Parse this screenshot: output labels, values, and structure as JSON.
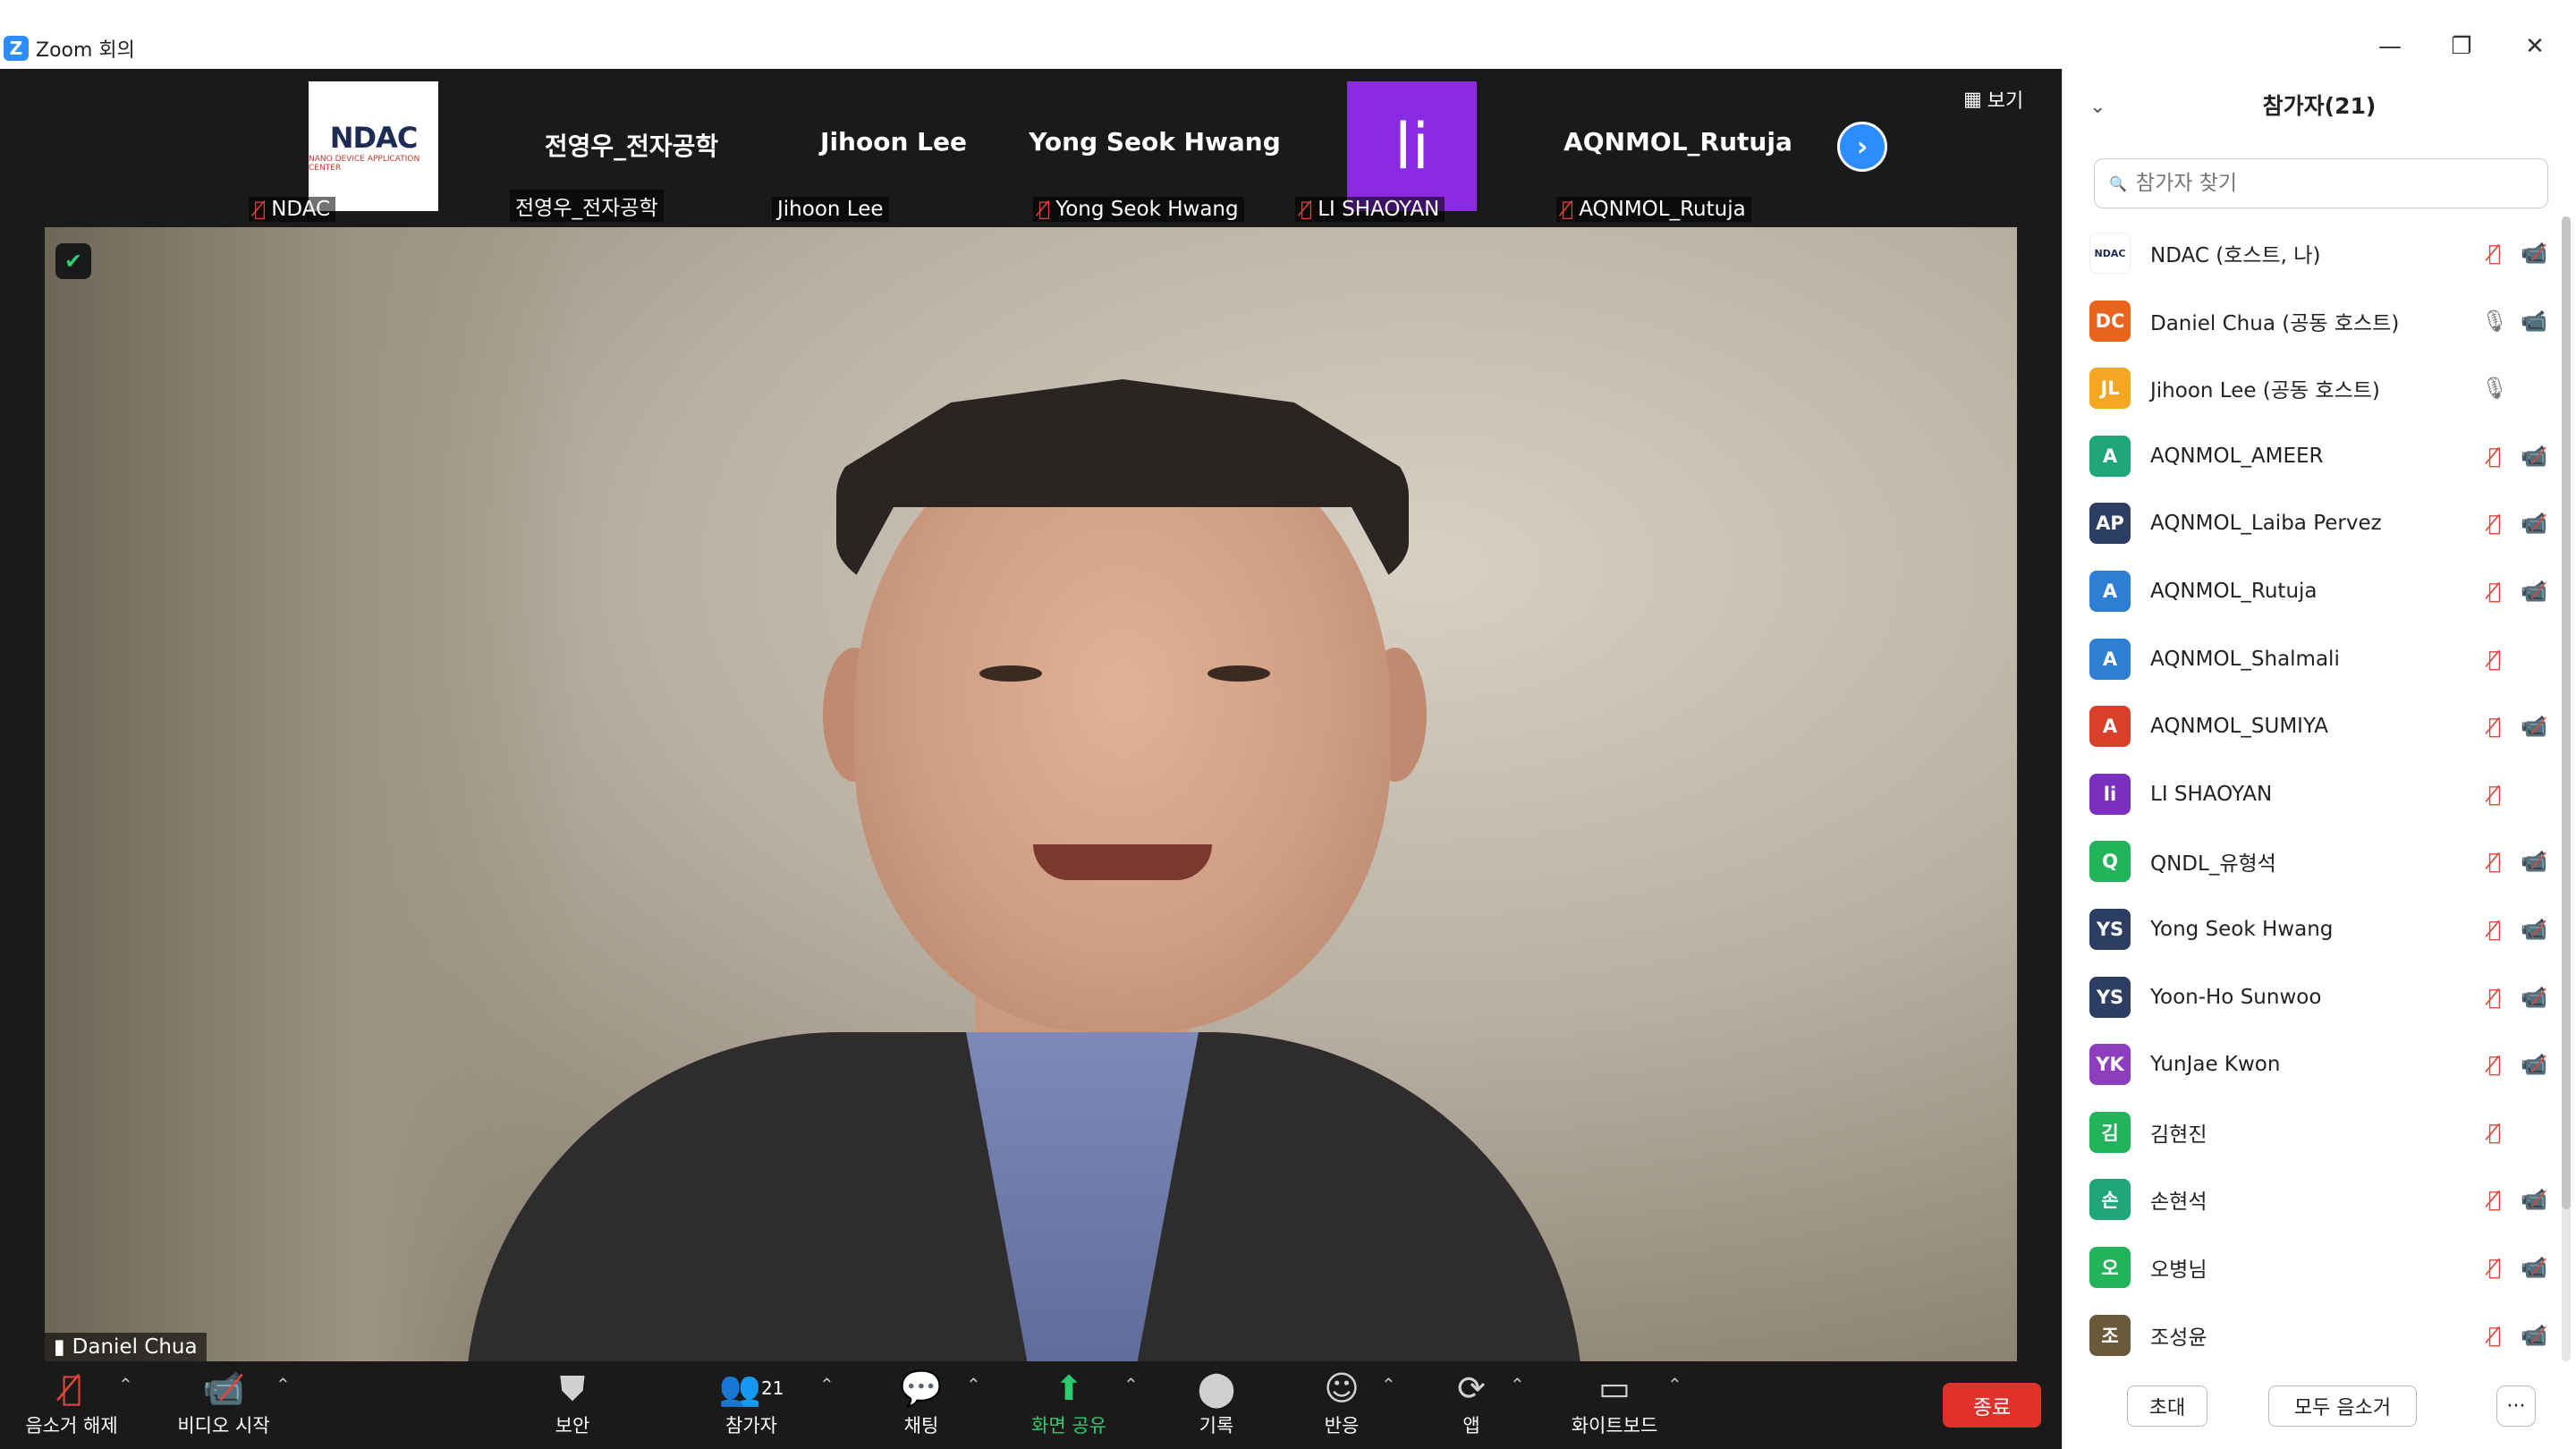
{
  "window": {
    "title": "Zoom 회의",
    "logo_letter": "Z",
    "minimize": "—",
    "restore": "❐",
    "close": "✕"
  },
  "strip": {
    "tiles": [
      {
        "label": "NDAC",
        "logo_text": "NDAC",
        "logo_small": "NANO DEVICE APPLICATION CENTER",
        "muted": true
      },
      {
        "center_name": "전영우_전자공학",
        "label": "전영우_전자공학",
        "muted": false
      },
      {
        "center_name": "Jihoon Lee",
        "label": "Jihoon Lee",
        "muted": false
      },
      {
        "center_name": "Yong Seok Hwang",
        "label": "Yong Seok Hwang",
        "muted": true
      },
      {
        "avatar": "li",
        "label": "LI SHAOYAN",
        "muted": true
      },
      {
        "center_name": "AQNMOL_Rutuja",
        "label": "AQNMOL_Rutuja",
        "muted": true
      }
    ],
    "next_icon": "›",
    "view_label": "보기"
  },
  "main_video": {
    "speaker": "Daniel Chua"
  },
  "toolbar": {
    "unmute": "음소거 해제",
    "start_video": "비디오 시작",
    "security": "보안",
    "participants": "참가자",
    "participants_count": "21",
    "chat": "채팅",
    "share_screen": "화면 공유",
    "record": "기록",
    "reactions": "반응",
    "apps": "앱",
    "whiteboard": "화이트보드",
    "end": "종료"
  },
  "panel": {
    "title": "참가자(21)",
    "search_placeholder": "참가자 찾기",
    "invite": "초대",
    "mute_all": "모두 음소거",
    "more": "···",
    "participants": [
      {
        "initials": "NDAC",
        "name": "NDAC (호스트, 나)",
        "color": "#ffffff",
        "mic": "muted",
        "cam": "off"
      },
      {
        "initials": "DC",
        "name": "Daniel Chua (공동 호스트)",
        "color": "#e8631c",
        "mic": "on",
        "cam": "on"
      },
      {
        "initials": "JL",
        "name": "Jihoon Lee (공동 호스트)",
        "color": "#f5a623",
        "mic": "on",
        "cam": "none"
      },
      {
        "initials": "A",
        "name": "AQNMOL_AMEER",
        "color": "#1fa67a",
        "mic": "muted",
        "cam": "off"
      },
      {
        "initials": "AP",
        "name": "AQNMOL_Laiba Pervez",
        "color": "#2c3e63",
        "mic": "muted",
        "cam": "off"
      },
      {
        "initials": "A",
        "name": "AQNMOL_Rutuja",
        "color": "#2d7fd3",
        "mic": "muted",
        "cam": "off"
      },
      {
        "initials": "A",
        "name": "AQNMOL_Shalmali",
        "color": "#2d7fd3",
        "mic": "muted",
        "cam": "none"
      },
      {
        "initials": "A",
        "name": "AQNMOL_SUMIYA",
        "color": "#d9402b",
        "mic": "muted",
        "cam": "off"
      },
      {
        "initials": "li",
        "name": "LI SHAOYAN",
        "color": "#7b2fbe",
        "mic": "muted",
        "cam": "none"
      },
      {
        "initials": "Q",
        "name": "QNDL_유형석",
        "color": "#23b35a",
        "mic": "muted",
        "cam": "off"
      },
      {
        "initials": "YS",
        "name": "Yong Seok Hwang",
        "color": "#2c3e63",
        "mic": "muted",
        "cam": "off"
      },
      {
        "initials": "YS",
        "name": "Yoon-Ho Sunwoo",
        "color": "#2c3e63",
        "mic": "muted",
        "cam": "off"
      },
      {
        "initials": "YK",
        "name": "YunJae Kwon",
        "color": "#8e3dbf",
        "mic": "muted",
        "cam": "off"
      },
      {
        "initials": "김",
        "name": "김현진",
        "color": "#23b35a",
        "mic": "muted",
        "cam": "none"
      },
      {
        "initials": "손",
        "name": "손현석",
        "color": "#1fa67a",
        "mic": "muted",
        "cam": "off"
      },
      {
        "initials": "오",
        "name": "오병님",
        "color": "#23b35a",
        "mic": "muted",
        "cam": "off"
      },
      {
        "initials": "조",
        "name": "조성윤",
        "color": "#6b5a3a",
        "mic": "muted",
        "cam": "off"
      }
    ]
  }
}
